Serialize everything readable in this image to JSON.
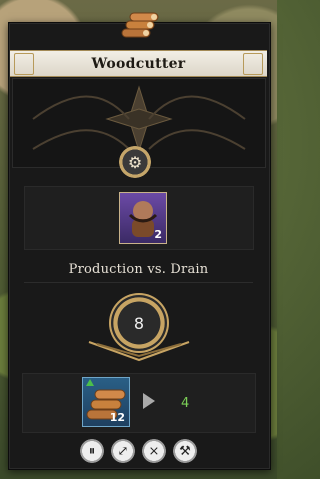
{
  "panel": {
    "title": "Woodcutter",
    "workers": {
      "count": "2"
    },
    "section_title": "Production vs. Drain",
    "gauge": {
      "value": "8"
    },
    "resource": {
      "quantity": "12",
      "output": "4"
    }
  },
  "colors": {
    "panel_bg": "#191919",
    "title_bg": "#f2efe6",
    "accent_gold": "#c7a463",
    "output_green": "#7ccf57",
    "worker_bg": "#6b4aa6",
    "resource_bg": "#2a5f86"
  },
  "icons": {
    "top_logs": "logs-icon",
    "settings": "gears-icon",
    "resource": "logs-icon",
    "pause": "pause-icon",
    "relocate": "relocate-icon",
    "cancel": "cancel-icon",
    "demolish": "hammer-icon"
  }
}
